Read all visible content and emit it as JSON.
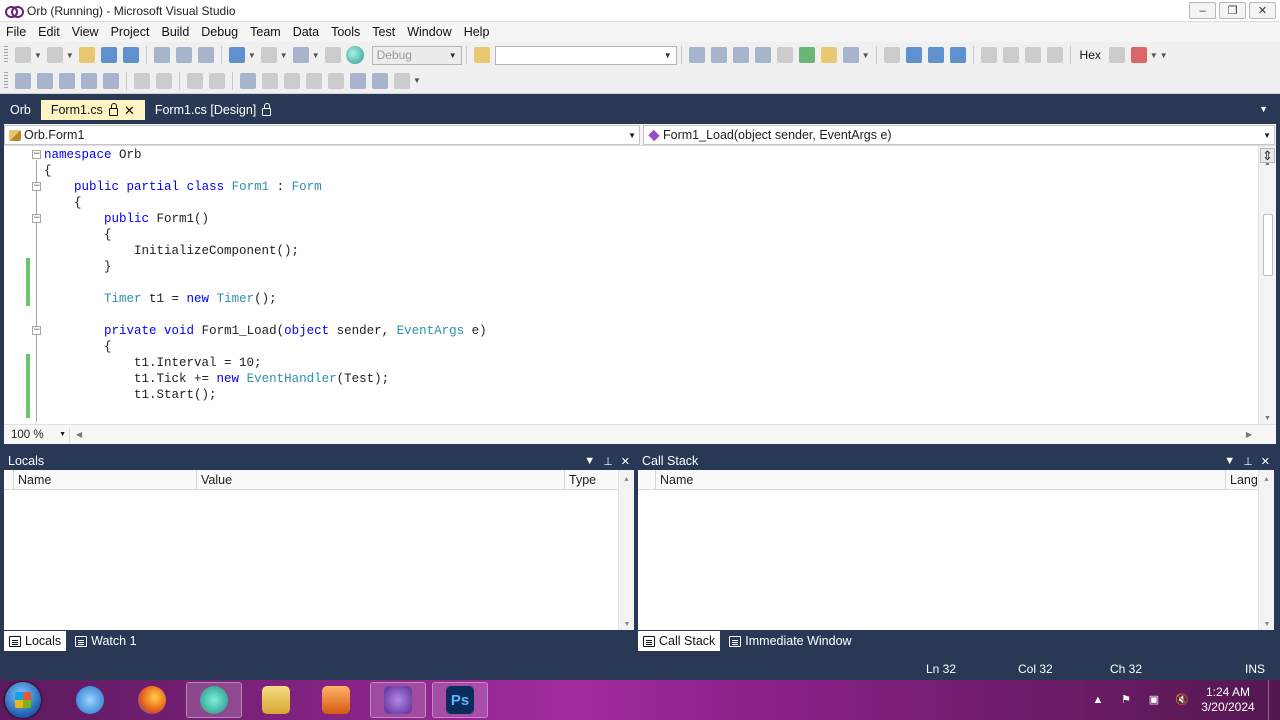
{
  "window": {
    "title": "Orb (Running) - Microsoft Visual Studio",
    "minimize": "–",
    "restore": "❐",
    "close": "✕"
  },
  "menu": [
    "File",
    "Edit",
    "View",
    "Project",
    "Build",
    "Debug",
    "Team",
    "Data",
    "Tools",
    "Test",
    "Window",
    "Help"
  ],
  "toolbar": {
    "config": "Debug",
    "platform": "",
    "hex_label": "Hex"
  },
  "tabs": {
    "orb": "Orb",
    "form1_cs": "Form1.cs",
    "form1_design": "Form1.cs [Design]"
  },
  "editor": {
    "class_combo": "Orb.Form1",
    "member_combo": "Form1_Load(object sender, EventArgs e)",
    "zoom": "100 %",
    "lines": [
      {
        "t": "namespace",
        "k": "kw",
        "rest": " Orb"
      },
      {
        "plain": "{"
      },
      {
        "plain": "    public partial class Form1 : Form"
      },
      {
        "plain": "    {"
      },
      {
        "plain": "        public Form1()"
      },
      {
        "plain": "        {"
      },
      {
        "plain": "            InitializeComponent();"
      },
      {
        "plain": "        }"
      },
      {
        "plain": ""
      },
      {
        "plain": "        Timer t1 = new Timer();"
      },
      {
        "plain": ""
      },
      {
        "plain": "        private void Form1_Load(object sender, EventArgs e)"
      },
      {
        "plain": "        {"
      },
      {
        "plain": "            t1.Interval = 10;"
      },
      {
        "plain": "            t1.Tick += new EventHandler(Test);"
      },
      {
        "plain": "            t1.Start();"
      }
    ]
  },
  "locals": {
    "title": "Locals",
    "columns": [
      "Name",
      "Value",
      "Type"
    ],
    "tabs": [
      "Locals",
      "Watch 1"
    ]
  },
  "callstack": {
    "title": "Call Stack",
    "columns": [
      "Name",
      "Lang"
    ],
    "tabs": [
      "Call Stack",
      "Immediate Window"
    ]
  },
  "status": {
    "ln": "Ln 32",
    "col": "Col 32",
    "ch": "Ch 32",
    "ins": "INS"
  },
  "taskbar": {
    "time": "1:24 AM",
    "date": "3/20/2024"
  },
  "colors": {
    "vs_frame": "#293955",
    "active_tab": "#fff5c4",
    "keyword": "#0000ff",
    "type": "#2b91af",
    "change_bar": "#6bc56b"
  }
}
